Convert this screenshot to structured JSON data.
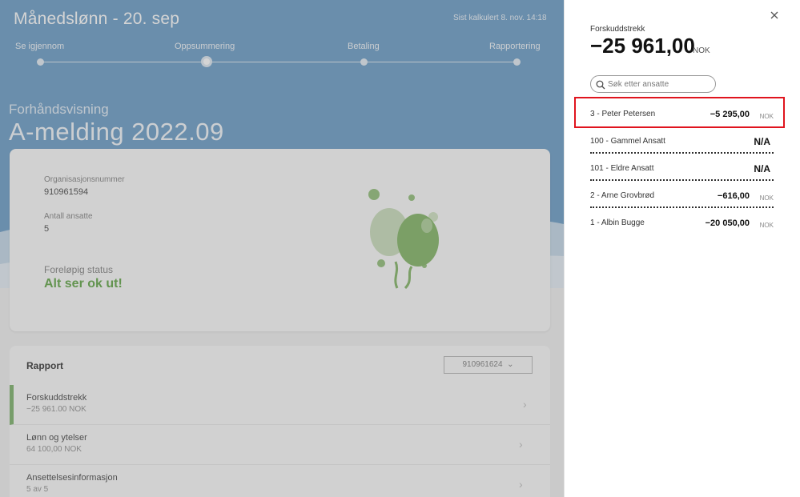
{
  "header": {
    "title": "Månedslønn - 20. sep",
    "calculated": "Sist kalkulert 8. nov. 14:18"
  },
  "stepper": {
    "steps": [
      {
        "label": "Se igjennom",
        "active": false
      },
      {
        "label": "Oppsummering",
        "active": true
      },
      {
        "label": "Betaling",
        "active": false
      },
      {
        "label": "Rapportering",
        "active": false
      }
    ]
  },
  "preview": {
    "kicker": "Forhåndsvisning",
    "title": "A-melding 2022.09"
  },
  "summary_card": {
    "org_label": "Organisasjonsnummer",
    "org_value": "910961594",
    "employees_label": "Antall ansatte",
    "employees_value": "5",
    "status_label": "Foreløpig status",
    "status_value": "Alt ser ok ut!",
    "illustration": "balloons-illustration"
  },
  "report": {
    "title": "Rapport",
    "org_select_value": "910961624",
    "rows": [
      {
        "name": "Forskuddstrekk",
        "sub": "−25 961.00 NOK",
        "active": true
      },
      {
        "name": "Lønn og ytelser",
        "sub": "64 100,00 NOK",
        "active": false
      },
      {
        "name": "Ansettelsesinformasjon",
        "sub": "5 av 5",
        "active": false
      }
    ]
  },
  "panel": {
    "kicker": "Forskuddstrekk",
    "total": "−25 961,00",
    "total_unit": "NOK",
    "search_placeholder": "Søk etter ansatte",
    "employees": [
      {
        "name": "3 - Peter Petersen",
        "amount": "−5 295,00",
        "unit": "NOK",
        "highlighted": true
      },
      {
        "name": "100 - Gammel Ansatt",
        "amount": "N/A",
        "unit": ""
      },
      {
        "name": "101 - Eldre Ansatt",
        "amount": "N/A",
        "unit": ""
      },
      {
        "name": "2 - Arne Grovbrød",
        "amount": "−616,00",
        "unit": "NOK"
      },
      {
        "name": "1 - Albin Bugge",
        "amount": "−20 050,00",
        "unit": "NOK"
      }
    ]
  },
  "colors": {
    "hero": "#78a6cc",
    "accent_green": "#6fae57",
    "highlight_red": "#e0141e"
  }
}
